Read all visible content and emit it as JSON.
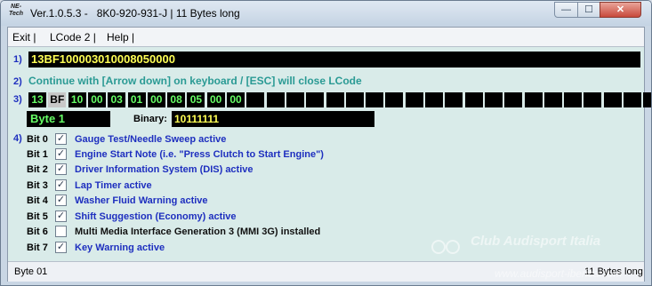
{
  "window": {
    "logo_text": "NE-Tech",
    "title": "Ver.1.0.5.3 -   8K0-920-931-J | 11 Bytes long",
    "minimize_glyph": "—",
    "maximize_glyph": "☐",
    "close_glyph": "✕"
  },
  "menu": [
    {
      "label": "Exit |"
    },
    {
      "label": "LCode 2 |"
    },
    {
      "label": "Help |"
    }
  ],
  "steps": {
    "s1": "1)",
    "s2": "2)",
    "s3": "3)",
    "s4": "4)"
  },
  "coding": {
    "code": "13BF100003010008050000",
    "instruction": "Continue with [Arrow down] on keyboard / [ESC] will close LCode",
    "bytes": [
      "13",
      "BF",
      "10",
      "00",
      "03",
      "01",
      "00",
      "08",
      "05",
      "00",
      "00",
      "",
      "",
      "",
      "",
      "",
      "",
      "",
      "",
      "",
      "",
      "",
      "",
      "",
      "",
      "",
      "",
      "",
      "",
      "",
      "",
      ""
    ],
    "selected_index": 1,
    "byte_label": "Byte 1",
    "binary_caption": "Binary:",
    "binary_value": "10111111"
  },
  "bits": [
    {
      "label": "Bit 0",
      "checked": true,
      "text": "Gauge Test/Needle Sweep active"
    },
    {
      "label": "Bit 1",
      "checked": true,
      "text": "Engine Start Note (i.e. \"Press Clutch to Start Engine\")"
    },
    {
      "label": "Bit 2",
      "checked": true,
      "text": "Driver Information System (DIS) active"
    },
    {
      "label": "Bit 3",
      "checked": true,
      "text": "Lap Timer active"
    },
    {
      "label": "Bit 4",
      "checked": true,
      "text": "Washer Fluid Warning active"
    },
    {
      "label": "Bit 5",
      "checked": true,
      "text": "Shift Suggestion (Economy) active"
    },
    {
      "label": "Bit 6",
      "checked": false,
      "text": "Multi Media Interface Generation 3 (MMI 3G) installed"
    },
    {
      "label": "Bit 7",
      "checked": true,
      "text": "Key Warning active"
    }
  ],
  "status": {
    "left": "Byte 01",
    "right": "11 Bytes long"
  },
  "watermark": {
    "text": "Club Audisport Italia",
    "url": "www.audisport-iberica.com"
  },
  "colors": {
    "active_text": "#1e2fbf",
    "inactive_text": "#111111",
    "byte_green": "#66ff66",
    "code_yellow": "#ffff55"
  }
}
